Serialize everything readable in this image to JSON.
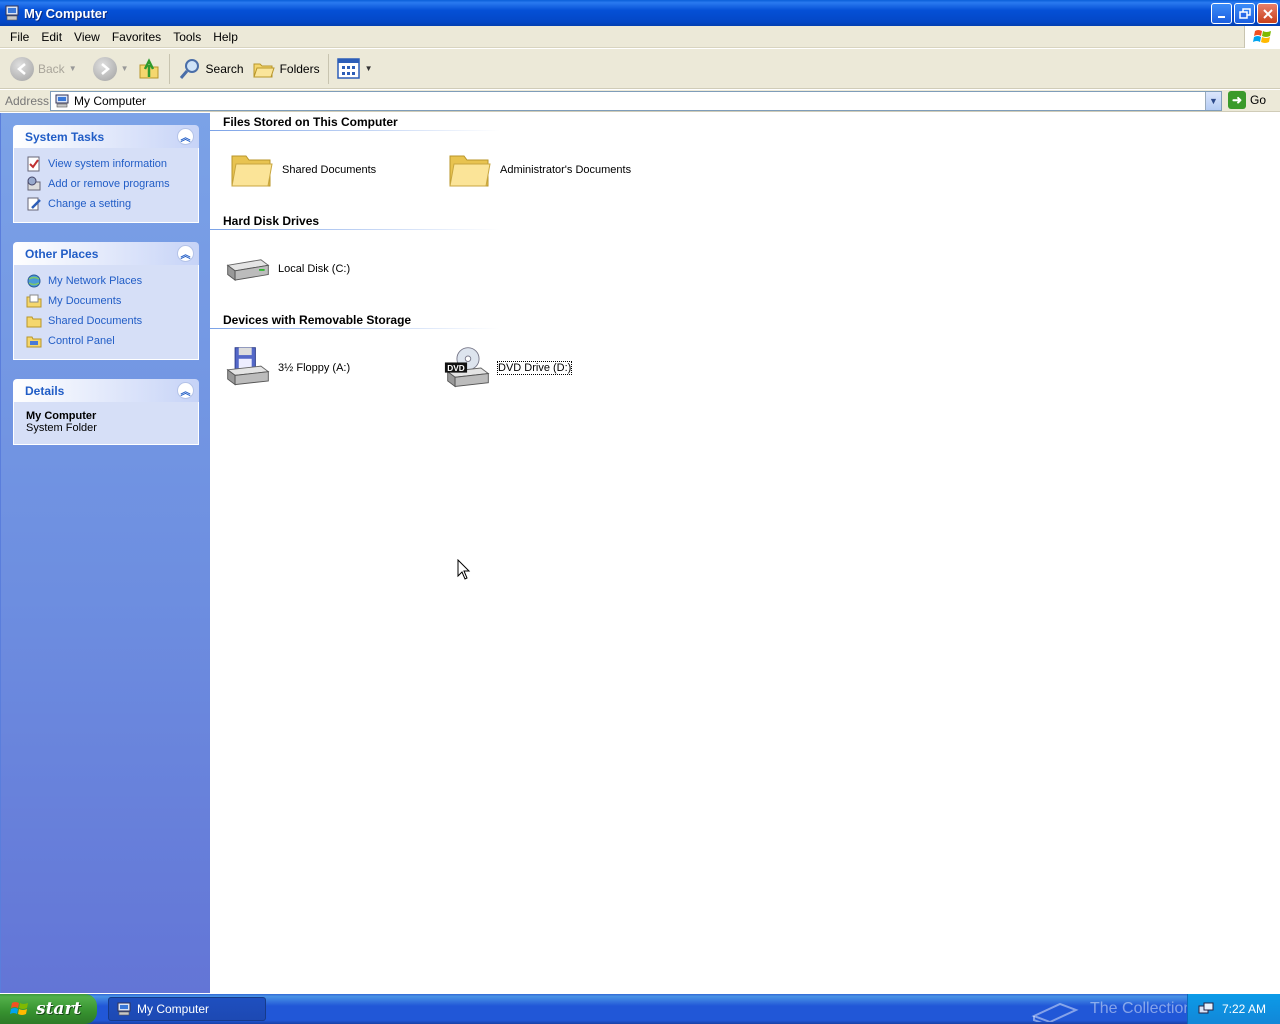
{
  "window": {
    "title": "My Computer"
  },
  "menu": {
    "items": [
      "File",
      "Edit",
      "View",
      "Favorites",
      "Tools",
      "Help"
    ]
  },
  "toolbar": {
    "back_label": "Back",
    "search_label": "Search",
    "folders_label": "Folders"
  },
  "address": {
    "label": "Address",
    "value": "My Computer",
    "go_label": "Go"
  },
  "taskpane": {
    "system_tasks": {
      "title": "System Tasks",
      "items": [
        "View system information",
        "Add or remove programs",
        "Change a setting"
      ]
    },
    "other_places": {
      "title": "Other Places",
      "items": [
        "My Network Places",
        "My Documents",
        "Shared Documents",
        "Control Panel"
      ]
    },
    "details": {
      "title": "Details",
      "name": "My Computer",
      "type": "System Folder"
    }
  },
  "content": {
    "groups": [
      {
        "title": "Files Stored on This Computer",
        "items": [
          "Shared Documents",
          "Administrator's Documents"
        ]
      },
      {
        "title": "Hard Disk Drives",
        "items": [
          "Local Disk (C:)"
        ]
      },
      {
        "title": "Devices with Removable Storage",
        "items": [
          "3½ Floppy (A:)",
          "DVD Drive (D:)"
        ]
      }
    ],
    "dvd_badge": "DVD"
  },
  "taskbar": {
    "start_label": "start",
    "window_button": "My Computer",
    "watermark": "The Collection Book",
    "clock": "7:22 AM"
  },
  "colors": {
    "title_bar": "#0550d6",
    "task_pane": "#7ba2e7",
    "link": "#215dc6",
    "start_button": "#36912f"
  }
}
